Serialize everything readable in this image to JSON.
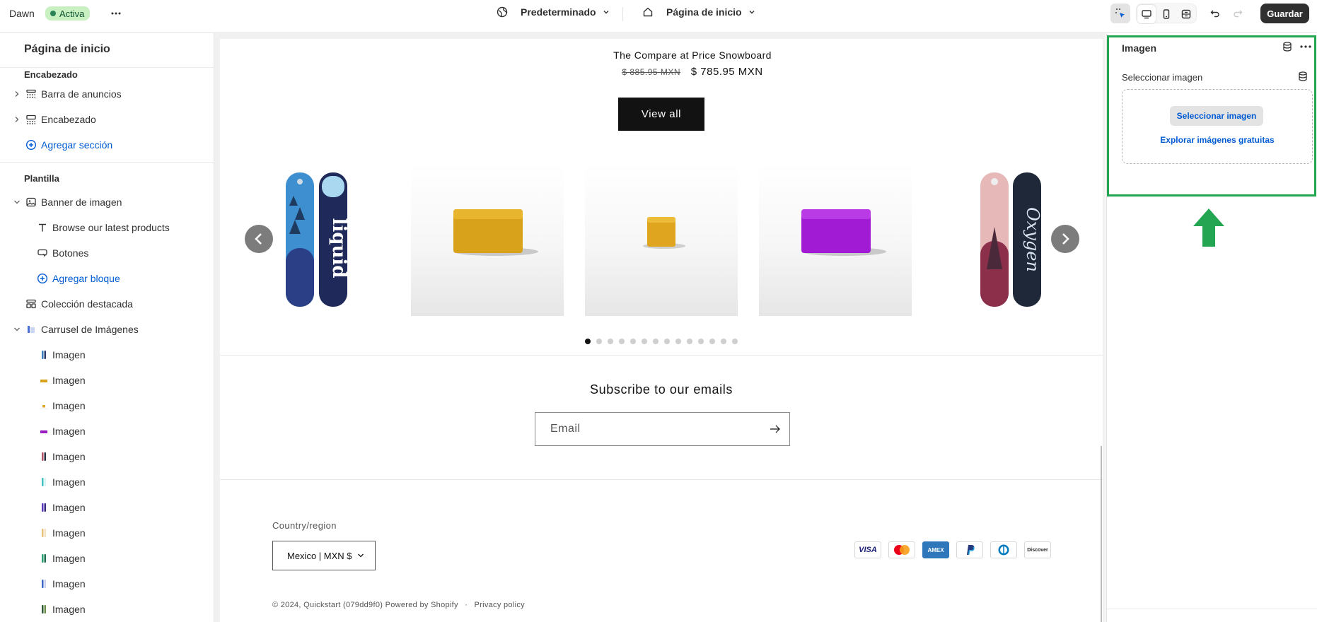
{
  "topbar": {
    "theme_name": "Dawn",
    "status_badge": "Activa",
    "template_selector": "Predeterminado",
    "page_selector": "Página de inicio",
    "save_label": "Guardar"
  },
  "sidebar": {
    "title": "Página de inicio",
    "header_group": {
      "heading": "Encabezado",
      "items": [
        {
          "label": "Barra de anuncios",
          "icon": "announcement-bar-icon"
        },
        {
          "label": "Encabezado",
          "icon": "header-layout-icon"
        }
      ],
      "add_label": "Agregar sección"
    },
    "template_group": {
      "heading": "Plantilla",
      "image_banner": "Banner de imagen",
      "banner_blocks": [
        {
          "label": "Browse our latest products",
          "icon": "text-icon"
        },
        {
          "label": "Botones",
          "icon": "button-icon"
        }
      ],
      "add_block_label": "Agregar bloque",
      "featured_collection": "Colección destacada",
      "carousel": "Carrusel de Imágenes",
      "carousel_images": [
        "Imagen",
        "Imagen",
        "Imagen",
        "Imagen",
        "Imagen",
        "Imagen",
        "Imagen",
        "Imagen",
        "Imagen",
        "Imagen",
        "Imagen"
      ]
    }
  },
  "preview": {
    "product_title": "The Compare at Price Snowboard",
    "compare_price": "$ 885.95 MXN",
    "price": "$ 785.95 MXN",
    "view_all": "View all",
    "carousel_slides": 14,
    "active_slide": 1,
    "newsletter_heading": "Subscribe to our emails",
    "email_placeholder": "Email",
    "country_label": "Country/region",
    "country_value": "Mexico | MXN $",
    "payment_methods": [
      "VISA",
      "Mastercard",
      "AMEX",
      "PayPal",
      "Diners",
      "Discover"
    ],
    "copyright": "© 2024, Quickstart (079dd9f0) Powered by Shopify",
    "privacy": "Privacy policy"
  },
  "settings_panel": {
    "title": "Imagen",
    "select_label": "Seleccionar imagen",
    "select_button": "Seleccionar imagen",
    "explore_link": "Explorar imágenes gratuitas",
    "highlight_color": "#23a552"
  }
}
